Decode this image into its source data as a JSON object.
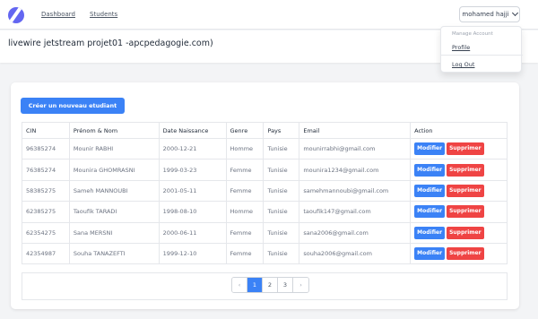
{
  "nav": {
    "links": [
      "Dashboard",
      "Students"
    ],
    "user_name": "mohamed hajji"
  },
  "header": {
    "title": "livewire jetstream projet01 -apcpedagogie.com)"
  },
  "dropdown": {
    "heading": "Manage Account",
    "profile": "Profile",
    "logout": "Log Out"
  },
  "main": {
    "create_button": "Créer un nouveau etudiant",
    "columns": [
      "CIN",
      "Prénom & Nom",
      "Date Naissance",
      "Genre",
      "Pays",
      "Email",
      "Action"
    ],
    "edit_label": "Modifier",
    "delete_label": "Supprimer",
    "rows": [
      [
        "96385274",
        "Mounir RABHI",
        "2000-12-21",
        "Homme",
        "Tunisie",
        "mounirrabhi@gmail.com"
      ],
      [
        "76385274",
        "Mounira GHOMRASNI",
        "1999-03-23",
        "Femme",
        "Tunisie",
        "mounira1234@gmail.com"
      ],
      [
        "58385275",
        "Sameh MANNOUBI",
        "2001-05-11",
        "Femme",
        "Tunisie",
        "samehmannoubi@gmail.com"
      ],
      [
        "62385275",
        "Taoufik TARADI",
        "1998-08-10",
        "Homme",
        "Tunisie",
        "taoufik147@gmail.com"
      ],
      [
        "62354275",
        "Sana MERSNI",
        "2000-06-11",
        "Femme",
        "Tunisie",
        "sana2006@gmail.com"
      ],
      [
        "42354987",
        "Souha TANAZEFTI",
        "1999-12-10",
        "Femme",
        "Tunisie",
        "souha2006@gmail.com"
      ]
    ]
  },
  "pagination": {
    "prev": "‹",
    "pages": [
      "1",
      "2",
      "3"
    ],
    "next": "›",
    "current": "1"
  }
}
